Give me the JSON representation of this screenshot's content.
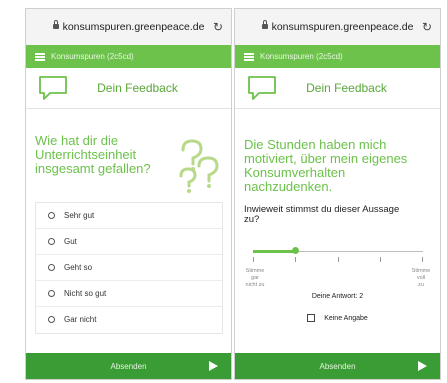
{
  "colors": {
    "brand_green": "#6cc24a",
    "submit_green": "#3a9c34"
  },
  "browser": {
    "url": "konsumspuren.greenpeace.de"
  },
  "app": {
    "title": "Konsumspuren (2c5cd)"
  },
  "feedback": {
    "title": "Dein Feedback"
  },
  "left": {
    "question": [
      "Wie hat dir die",
      "Unterrichtseinheit",
      "insgesamt gefallen?"
    ],
    "options": [
      "Sehr gut",
      "Gut",
      "Geht so",
      "Nicht so gut",
      "Gar nicht"
    ],
    "submit": "Absenden"
  },
  "right": {
    "statement": [
      "Die Stunden haben mich",
      "motiviert, über mein eigenes",
      "Konsumverhalten",
      "nachzudenken."
    ],
    "question": [
      "Inwieweit stimmst du dieser Aussage",
      "zu?"
    ],
    "scale_min": [
      "Stimme gar",
      "nicht zu"
    ],
    "scale_max": [
      "Stimme voll",
      "zu"
    ],
    "slider": {
      "min": 1,
      "max": 5,
      "value": 2
    },
    "answer": "Deine Antwort: 2",
    "no_answer": "Keine Angabe",
    "submit": "Absenden"
  }
}
